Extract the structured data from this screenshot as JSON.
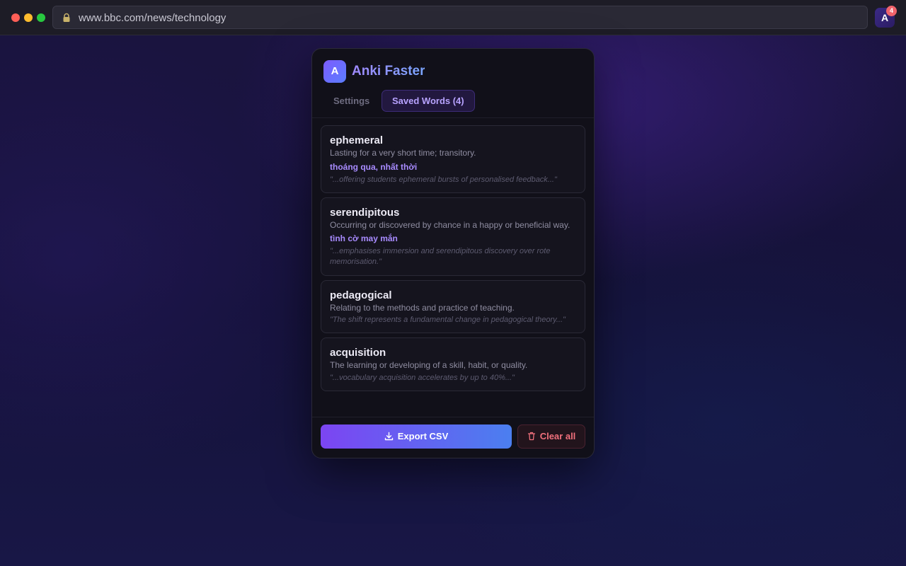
{
  "browser": {
    "url": "www.bbc.com/news/technology",
    "extension_letter": "A",
    "extension_badge": "4"
  },
  "popup": {
    "logo_letter": "A",
    "title": "Anki Faster",
    "tabs": [
      {
        "label": "Settings",
        "active": false
      },
      {
        "label": "Saved Words (4)",
        "active": true
      }
    ],
    "words": [
      {
        "word": "ephemeral",
        "definition": "Lasting for a very short time; transitory.",
        "translation": "thoáng qua, nhất thời",
        "context": "\"...offering students ephemeral bursts of personalised feedback...\""
      },
      {
        "word": "serendipitous",
        "definition": "Occurring or discovered by chance in a happy or beneficial way.",
        "translation": "tình cờ may mắn",
        "context": "\"...emphasises immersion and serendipitous discovery over rote memorisation.\""
      },
      {
        "word": "pedagogical",
        "definition": "Relating to the methods and practice of teaching.",
        "translation": "",
        "context": "\"The shift represents a fundamental change in pedagogical theory...\""
      },
      {
        "word": "acquisition",
        "definition": "The learning or developing of a skill, habit, or quality.",
        "translation": "",
        "context": "\"...vocabulary acquisition accelerates by up to 40%...\""
      }
    ],
    "export_label": "Export CSV",
    "clear_label": "Clear all",
    "colors": {
      "accent": "#a88bff",
      "danger": "#f0707c"
    }
  }
}
